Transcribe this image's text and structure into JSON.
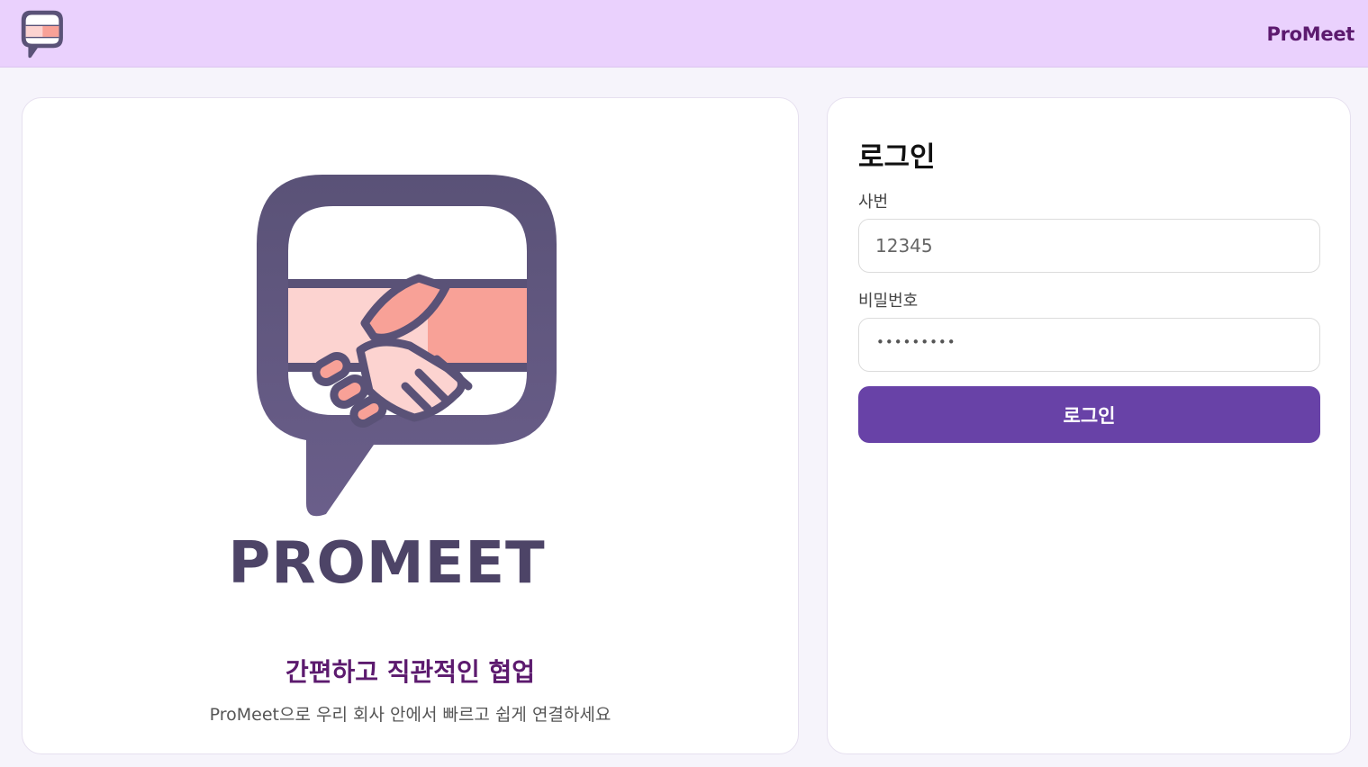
{
  "header": {
    "brand": "ProMeet",
    "logo_icon": "handshake-chat-icon"
  },
  "hero": {
    "wordmark": "PROMEET",
    "tagline": "간편하고 직관적인 협업",
    "subtext": "ProMeet으로 우리 회사 안에서 빠르고 쉽게 연결하세요",
    "logo_icon": "handshake-chat-icon"
  },
  "login": {
    "title": "로그인",
    "id_label": "사번",
    "id_placeholder": "12345",
    "password_label": "비밀번호",
    "password_mask": "•••••••••",
    "button_label": "로그인"
  },
  "colors": {
    "header_bg": "#ead1fd",
    "brand_text": "#5c1a6e",
    "button_bg": "#6842a7",
    "logo_dark": "#5a5277",
    "hand_light": "#fcd3d0",
    "hand_dark": "#f8a197"
  }
}
